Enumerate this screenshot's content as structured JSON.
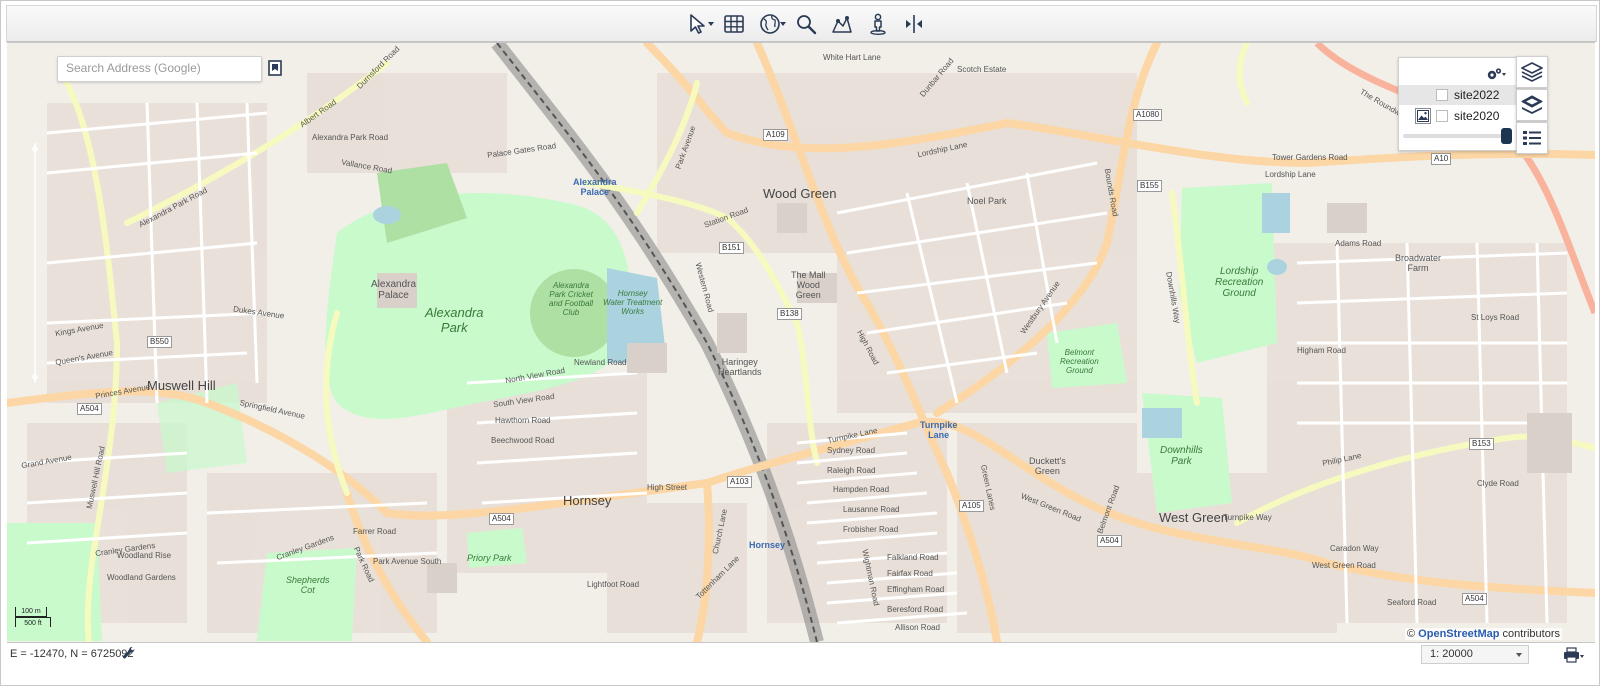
{
  "toolbar": {
    "tools": [
      {
        "name": "select-tool",
        "icon": "cursor-arrow-icon",
        "has_menu": true
      },
      {
        "name": "table-tool",
        "icon": "table-grid-icon",
        "has_menu": false
      },
      {
        "name": "globe-tool",
        "icon": "globe-icon",
        "has_menu": true
      },
      {
        "name": "zoom-tool",
        "icon": "magnifier-icon",
        "has_menu": false
      },
      {
        "name": "map-features-tool",
        "icon": "map-pins-icon",
        "has_menu": false
      },
      {
        "name": "street-view-tool",
        "icon": "pegman-icon",
        "has_menu": false
      },
      {
        "name": "swipe-tool",
        "icon": "split-arrows-icon",
        "has_menu": false
      }
    ]
  },
  "search": {
    "placeholder": "Search Address (Google)"
  },
  "layers": {
    "items": [
      {
        "label": "site2022",
        "checked": false,
        "has_thumbnail": false
      },
      {
        "label": "site2020",
        "checked": false,
        "has_thumbnail": true
      }
    ],
    "opacity": 1.0
  },
  "map": {
    "places": {
      "wood_green": "Wood Green",
      "muswell_hill": "Muswell Hill",
      "hornsey": "Hornsey",
      "west_green": "West Green",
      "alexandra_palace_building": "Alexandra\nPalace",
      "the_mall": "The Mall\nWood\nGreen",
      "haringey_heartlands": "Haringey\nHeartlands",
      "broadwater_farm": "Broadwater\nFarm",
      "duckets_green": "Duckett's\nGreen"
    },
    "parks": {
      "alexandra_park": "Alexandra\nPark",
      "cricket_club": "Alexandra\nPark Cricket\nand Football\nClub",
      "water_works": "Hornsey\nWater Treatment\nWorks",
      "lordship_rec": "Lordship\nRecreation\nGround",
      "belmont_rec": "Belmont\nRecreation\nGround",
      "downhills_park": "Downhills\nPark",
      "priory_park": "Priory Park",
      "shepherds_cot": "Shepherds\nCot"
    },
    "stations": {
      "alexandra_palace": "Alexandra\nPalace",
      "turnpike_lane": "Turnpike\nLane",
      "hornsey": "Hornsey"
    },
    "roads": {
      "alexandra_park_road": "Alexandra Park Road",
      "alexandra_park_road_2": "Alexandra Park Road",
      "palace_gates_road": "Palace Gates Road",
      "dukes_avenue": "Dukes Avenue",
      "muswell_hill_road": "Muswell Hill Road",
      "high_street": "High Street",
      "turnpike_lane": "Turnpike Lane",
      "lordship_lane": "Lordship Lane",
      "lordship_lane_2": "Lordship Lane",
      "west_green_road": "West Green Road",
      "west_green_road_2": "West Green Road",
      "philip_lane": "Philip Lane",
      "green_lanes": "Green Lanes",
      "westbury_avenue": "Westbury Avenue",
      "high_road": "High Road",
      "wightman_road": "Wightman Road",
      "tottenham_lane": "Tottenham Lane",
      "church_lane": "Church Lane",
      "park_road": "Park Road",
      "cranley_gardens": "Cranley Gardens",
      "cranley_gardens_2": "Cranley Gardens",
      "station_road": "Station Road",
      "durnsford_road": "Durnsford Road",
      "albert_road": "Albert Road",
      "vallance_road": "Vallance Road",
      "newland_road": "Newland Road",
      "north_view_road": "North View Road",
      "south_view_road": "South View Road",
      "hawthorn_road": "Hawthorn Road",
      "beechwood_road": "Beechwood Road",
      "springfield_avenue": "Springfield Avenue",
      "princes_avenue": "Princes Avenue",
      "queens_avenue": "Queen's Avenue",
      "kings_avenue": "Kings Avenue",
      "grand_avenue": "Grand Avenue",
      "western_road": "Western Road",
      "park_avenue": "Park Avenue",
      "downhills_way": "Downhills Way",
      "belmont_road": "Belmont Road",
      "higham_road": "Higham Road",
      "st_loys_road": "St Loys Road",
      "adams_road": "Adams Road",
      "the_roundway": "The Roundway",
      "bounds_road": "Bounds Road",
      "farrer_road": "Farrer Road",
      "woodland_rise": "Woodland Rise",
      "woodland_gardens": "Woodland Gardens",
      "park_avenue_south": "Park Avenue South",
      "lightfoot_road": "Lightfoot Road",
      "falkland_road": "Falkland Road",
      "fairfax_road": "Fairfax Road",
      "effingham_road": "Effingham Road",
      "beresford_road": "Beresford Road",
      "allison_road": "Allison Road",
      "sydney_road": "Sydney Road",
      "raleigh_road": "Raleigh Road",
      "hampden_road": "Hampden Road",
      "frobisher_road": "Frobisher Road",
      "lausanne_road": "Lausanne Road",
      "noel_park": "Noel Park",
      "white_hart_lane": "White Hart Lane",
      "scotch_estate": "Scotch Estate",
      "dunbar_road": "Dunbar Road",
      "tower_gardens_road": "Tower Gardens Road",
      "caradon_way": "Caradon Way",
      "clyde_road": "Clyde Road",
      "seaford_road": "Seaford Road",
      "turnpike_way": "Turnpike Way"
    },
    "shields": {
      "a504_west": "A504",
      "a504_mid": "A504",
      "a504_east": "A504",
      "a504_far_east": "A504",
      "a103": "A103",
      "a105": "A105",
      "a109": "A109",
      "a10": "A10",
      "a1080": "A1080",
      "b550": "B550",
      "b151": "B151",
      "b138": "B138",
      "b155": "B155",
      "b153": "B153"
    }
  },
  "scalebar": {
    "metric": "100 m",
    "imperial": "500 ft"
  },
  "attribution": {
    "prefix": "©",
    "osm": "OpenStreetMap",
    "suffix": "contributors"
  },
  "status": {
    "coords": "E = -12470, N = 6725092",
    "scale": "1: 20000"
  },
  "colors": {
    "map_background": "#f2efe9",
    "park": "#c8facc",
    "park_dark": "#aedfa3",
    "water": "#aad3df",
    "primary_road": "#fcd6a4",
    "secondary_road": "#f7fabf",
    "railway": "#777777",
    "trunk_road": "#f9b29c",
    "building": "#d9d0c9",
    "icon": "#2b3a55"
  }
}
